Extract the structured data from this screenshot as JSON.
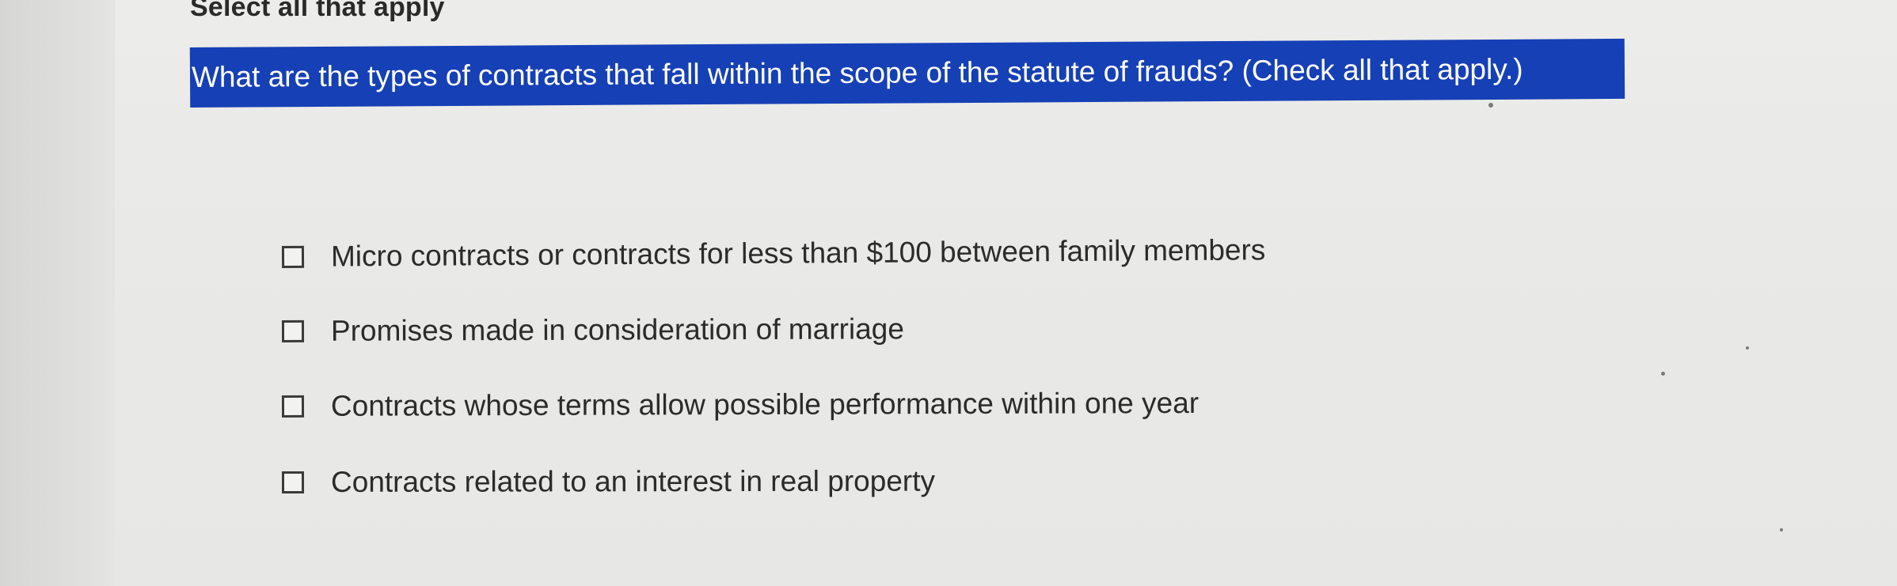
{
  "instruction": "Select all that apply",
  "question": "What are the types of contracts that fall within the scope of the statute of frauds? (Check all that apply.)",
  "options": [
    {
      "label": "Micro contracts or contracts for less than $100 between family members",
      "checked": false
    },
    {
      "label": "Promises made in consideration of marriage",
      "checked": false
    },
    {
      "label": "Contracts whose terms allow possible performance within one year",
      "checked": false
    },
    {
      "label": "Contracts related to an interest in real property",
      "checked": false
    }
  ],
  "colors": {
    "highlight": "#1640b5",
    "text": "#2b2b2b",
    "background": "#e9e9e7"
  }
}
